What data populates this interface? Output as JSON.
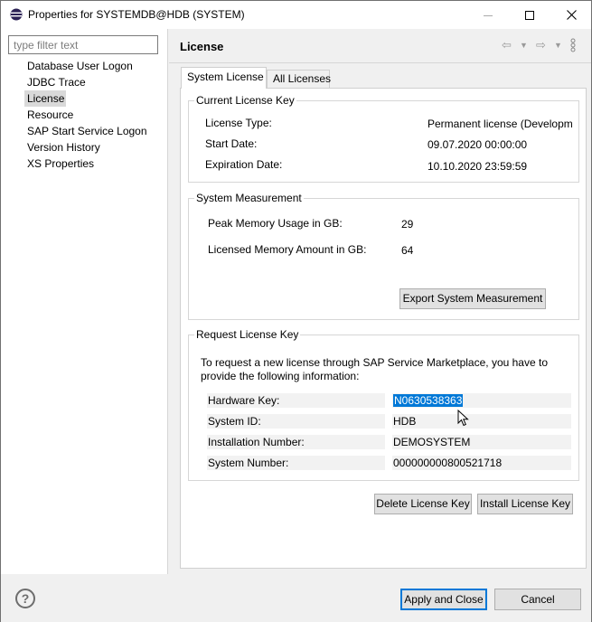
{
  "window": {
    "title": "Properties for SYSTEMDB@HDB (SYSTEM)"
  },
  "sidebar": {
    "filter_placeholder": "type filter text",
    "items": [
      {
        "label": "Database User Logon"
      },
      {
        "label": "JDBC Trace"
      },
      {
        "label": "License",
        "selected": true
      },
      {
        "label": "Resource"
      },
      {
        "label": "SAP Start Service Logon"
      },
      {
        "label": "Version History"
      },
      {
        "label": "XS Properties"
      }
    ]
  },
  "page": {
    "title": "License",
    "tabs": [
      {
        "label": "System License",
        "active": true
      },
      {
        "label": "All Licenses"
      }
    ]
  },
  "current_license": {
    "title": "Current License Key",
    "license_type_label": "License Type:",
    "license_type_value": "Permanent license (Developm",
    "start_date_label": "Start Date:",
    "start_date_value": "09.07.2020 00:00:00",
    "expiration_date_label": "Expiration Date:",
    "expiration_date_value": "10.10.2020 23:59:59"
  },
  "system_measurement": {
    "title": "System Measurement",
    "peak_label": "Peak Memory Usage in GB:",
    "peak_value": "29",
    "licensed_label": "Licensed Memory Amount in GB:",
    "licensed_value": "64",
    "export_button": "Export System Measurement"
  },
  "request_license": {
    "title": "Request License Key",
    "instruction_line1": "To request a new license through SAP Service Marketplace, you have to",
    "instruction_line2": "provide the following information:",
    "fields": [
      {
        "key": "Hardware Key:",
        "value": "N0630538363",
        "selected": true
      },
      {
        "key": "System ID:",
        "value": "HDB"
      },
      {
        "key": "Installation Number:",
        "value": "DEMOSYSTEM"
      },
      {
        "key": "System Number:",
        "value": "000000000800521718"
      }
    ]
  },
  "actions": {
    "delete_button": "Delete License Key",
    "install_button": "Install License Key"
  },
  "footer": {
    "help_label": "?",
    "apply_close_button": "Apply and Close",
    "cancel_button": "Cancel"
  },
  "colors": {
    "accent": "#0078d7",
    "selection": "#0078d7",
    "tree_selected": "#d9d9d9"
  }
}
